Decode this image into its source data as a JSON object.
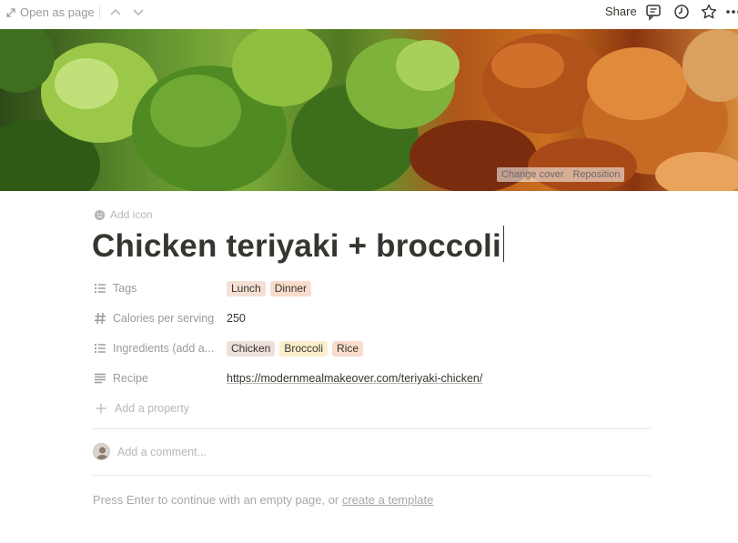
{
  "topbar": {
    "open_as_page": "Open as page",
    "share": "Share"
  },
  "cover": {
    "change_cover": "Change cover",
    "reposition": "Reposition"
  },
  "page": {
    "add_icon": "Add icon",
    "title": "Chicken teriyaki + broccoli"
  },
  "properties": {
    "tags": {
      "name": "Tags",
      "values": [
        {
          "label": "Lunch",
          "color": "#f5e0d5"
        },
        {
          "label": "Dinner",
          "color": "#f9dccb"
        }
      ]
    },
    "calories": {
      "name": "Calories per serving",
      "value": "250"
    },
    "ingredients": {
      "name": "Ingredients (add a...",
      "values": [
        {
          "label": "Chicken",
          "color": "#eee0da"
        },
        {
          "label": "Broccoli",
          "color": "#fbeecc"
        },
        {
          "label": "Rice",
          "color": "#f9dccb"
        }
      ]
    },
    "recipe": {
      "name": "Recipe",
      "value": "https://modernmealmakeover.com/teriyaki-chicken/"
    }
  },
  "add_property": "Add a property",
  "comment": {
    "placeholder": "Add a comment..."
  },
  "empty_hint": {
    "prefix": "Press Enter to continue with an empty page, or ",
    "link": "create a template"
  },
  "colors": {
    "text": "#37352f",
    "muted": "#9b9a97"
  }
}
